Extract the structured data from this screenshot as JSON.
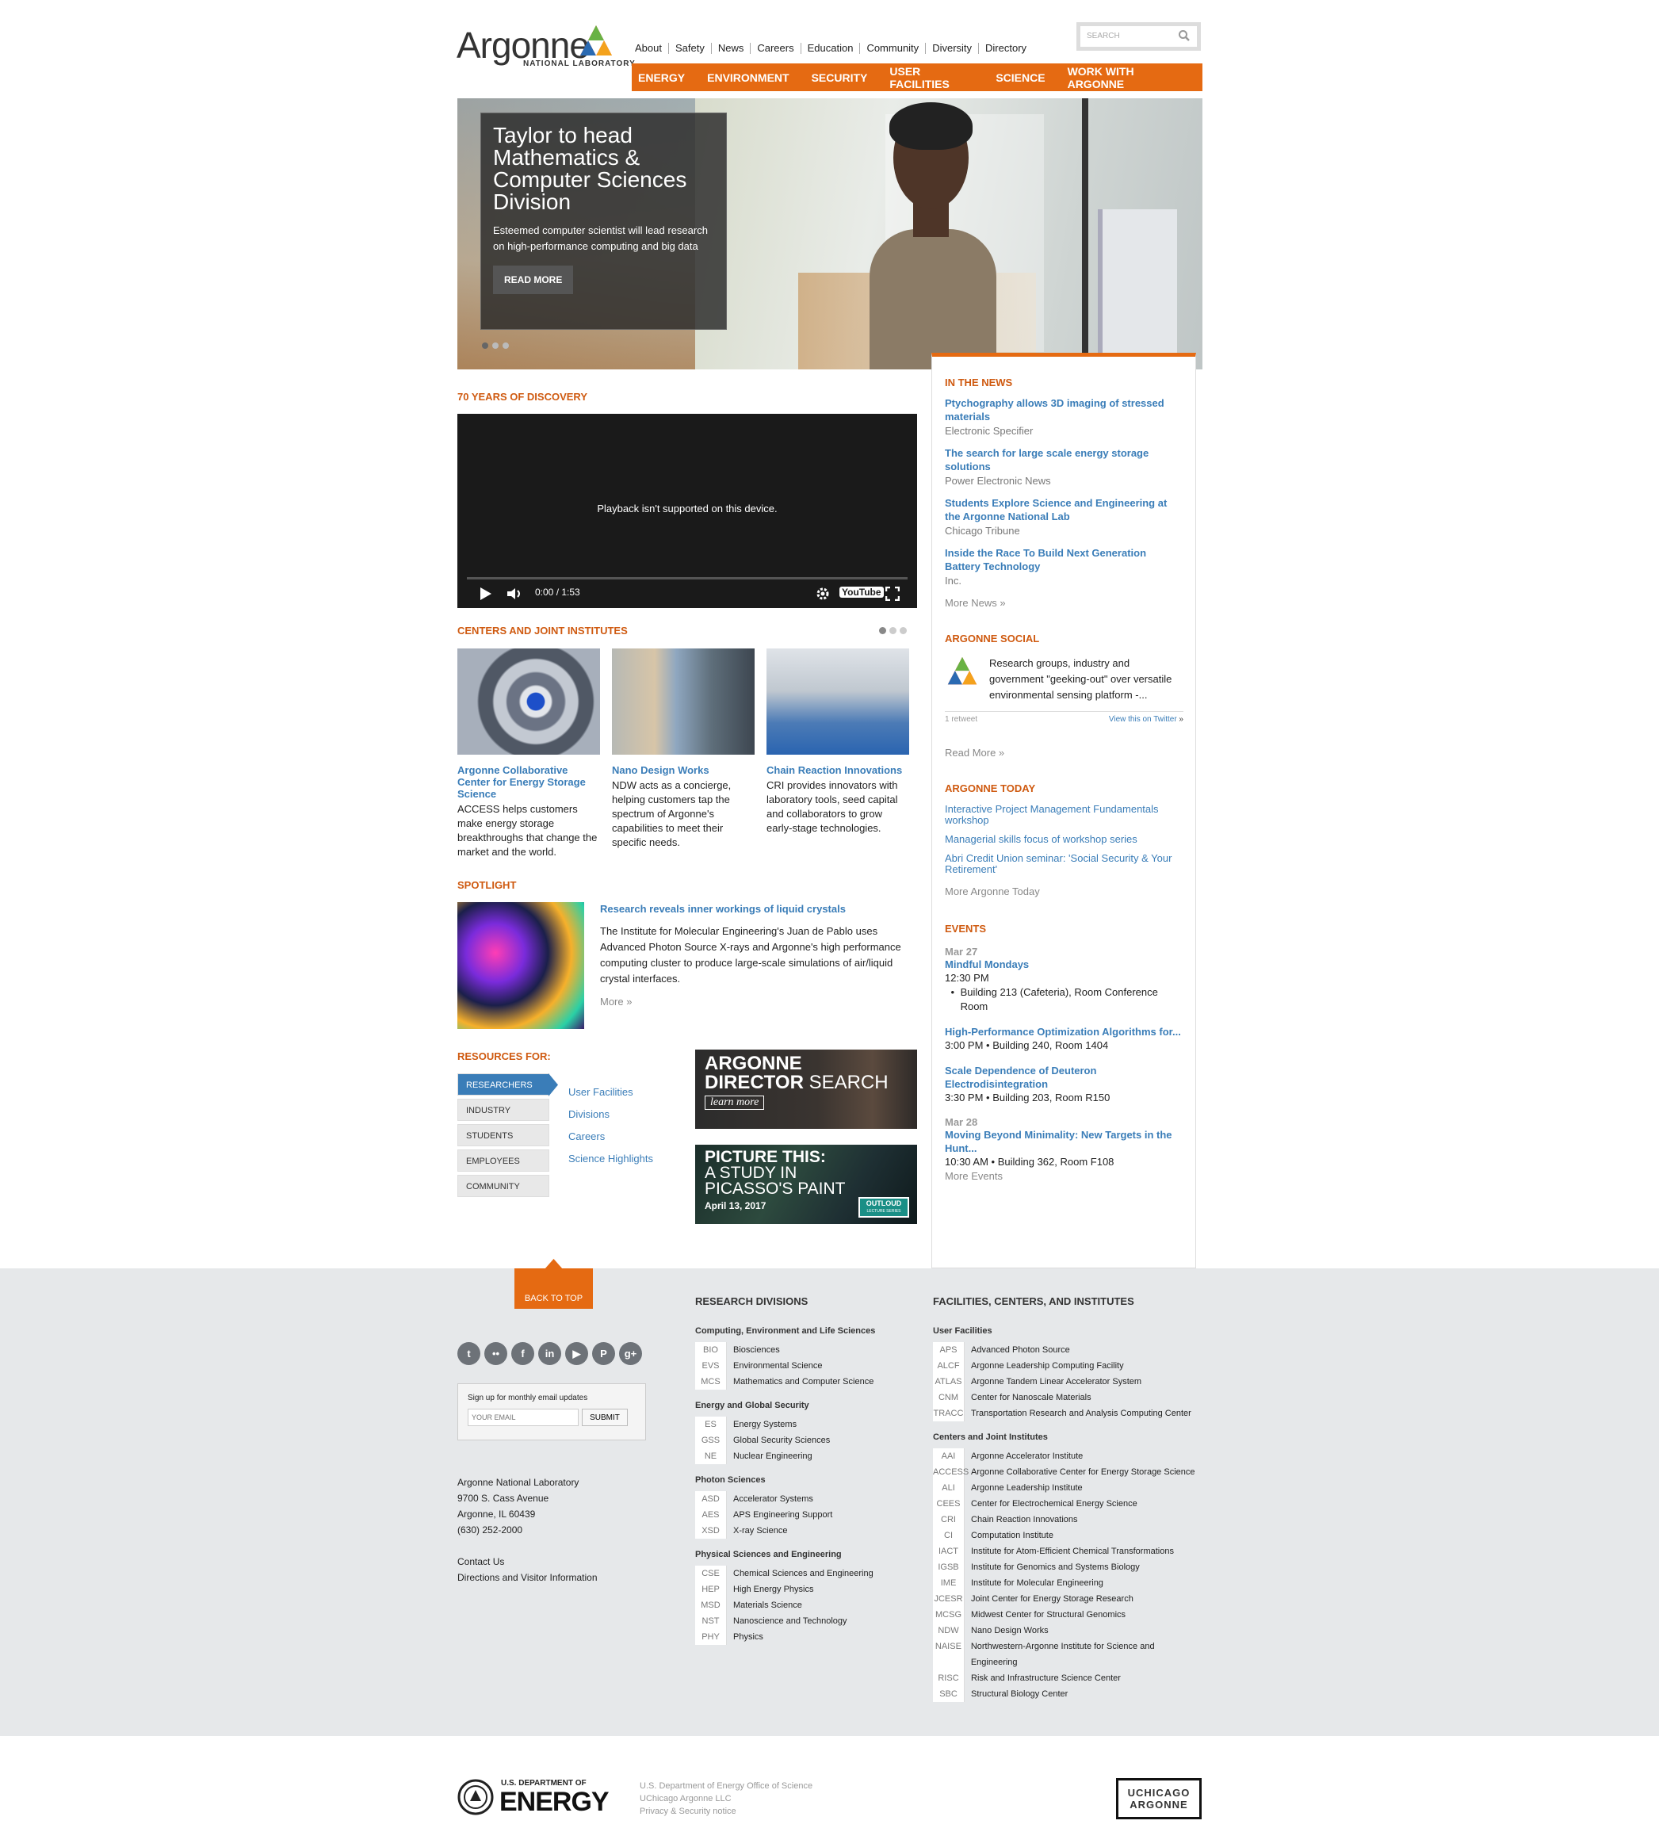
{
  "header": {
    "logo_text": "Argonne",
    "logo_sub": "NATIONAL LABORATORY",
    "top_nav": [
      "About",
      "Safety",
      "News",
      "Careers",
      "Education",
      "Community",
      "Diversity",
      "Directory"
    ],
    "search_placeholder": "SEARCH",
    "main_nav": [
      "ENERGY",
      "ENVIRONMENT",
      "SECURITY",
      "USER FACILITIES",
      "SCIENCE",
      "WORK WITH ARGONNE"
    ]
  },
  "hero": {
    "title": "Taylor to head Mathematics & Computer Sciences Division",
    "desc": "Esteemed computer scientist will lead research on high-performance computing and big data",
    "button": "READ MORE"
  },
  "discovery": {
    "title": "70 YEARS OF DISCOVERY",
    "video_msg": "Playback isn't supported on this device.",
    "video_time": "0:00 / 1:53",
    "youtube": "YouTube"
  },
  "centers": {
    "title": "CENTERS AND JOINT INSTITUTES",
    "items": [
      {
        "title": "Argonne Collaborative Center for Energy Storage Science",
        "text": "ACCESS helps customers make energy storage breakthroughs that change the market and the world."
      },
      {
        "title": "Nano Design Works",
        "text": "NDW acts as a concierge, helping customers tap the spectrum of Argonne's capabilities to meet their specific needs."
      },
      {
        "title": "Chain Reaction Innovations",
        "text": "CRI provides innovators with laboratory tools, seed capital and collaborators to grow early-stage technologies."
      }
    ]
  },
  "spotlight": {
    "title": "SPOTLIGHT",
    "headline": "Research reveals inner workings of liquid crystals",
    "text": "The Institute for Molecular Engineering's Juan de Pablo uses Advanced Photon Source X-rays and Argonne's high performance computing cluster to produce large-scale simulations of air/liquid crystal interfaces.",
    "more": "More"
  },
  "resources": {
    "title": "RESOURCES FOR:",
    "tabs": [
      "RESEARCHERS",
      "INDUSTRY",
      "STUDENTS",
      "EMPLOYEES",
      "COMMUNITY"
    ],
    "links": [
      "User Facilities",
      "Divisions",
      "Careers",
      "Science Highlights"
    ]
  },
  "ads": {
    "ad1_line1": "ARGONNE",
    "ad1_line2": "DIRECTOR",
    "ad1_line3": "SEARCH",
    "ad1_cta": "learn more",
    "ad2_line1": "PICTURE THIS:",
    "ad2_line2": "A STUDY IN",
    "ad2_line3": "PICASSO'S PAINT",
    "ad2_date": "April 13, 2017",
    "ad2_badge": "OUTLOUD",
    "ad2_badge_sub": "LECTURE SERIES"
  },
  "in_the_news": {
    "title": "IN THE NEWS",
    "items": [
      {
        "title": "Ptychography allows 3D imaging of stressed materials",
        "src": "Electronic Specifier"
      },
      {
        "title": "The search for large scale energy storage solutions",
        "src": "Power Electronic News"
      },
      {
        "title": "Students Explore Science and Engineering at the Argonne National Lab",
        "src": "Chicago Tribune"
      },
      {
        "title": "Inside the Race To Build Next Generation Battery Technology",
        "src": "Inc."
      }
    ],
    "more": "More News"
  },
  "social": {
    "title": "ARGONNE SOCIAL",
    "tweet": "Research groups, industry and government \"geeking-out\" over versatile environmental sensing platform -...",
    "retweets": "1 retweet",
    "view": "View this on Twitter",
    "more": "Read More"
  },
  "today": {
    "title": "ARGONNE TODAY",
    "items": [
      "Interactive Project Management Fundamentals workshop",
      "Managerial skills focus of workshop series",
      "Abri Credit Union seminar: 'Social Security & Your Retirement'"
    ],
    "more": "More Argonne Today"
  },
  "events": {
    "title": "EVENTS",
    "date1": "Mar 27",
    "e1_title": "Mindful Mondays",
    "e1_time": "12:30 PM",
    "e1_loc": "Building 213 (Cafeteria), Room Conference Room",
    "e2_title": "High-Performance Optimization Algorithms for...",
    "e2_meta": "3:00 PM  •  Building 240, Room 1404",
    "e3_title": "Scale Dependence of Deuteron Electrodisintegration",
    "e3_meta": "3:30 PM  •  Building 203, Room R150",
    "date2": "Mar 28",
    "e4_title": "Moving Beyond Minimality: New Targets in the Hunt...",
    "e4_meta": "10:30 AM  •  Building 362, Room F108",
    "more": "More Events"
  },
  "footer": {
    "back_top": "BACK TO TOP",
    "social_icons": [
      "twitter-icon",
      "flickr-icon",
      "facebook-icon",
      "linkedin-icon",
      "youtube-icon",
      "pinterest-icon",
      "googleplus-icon"
    ],
    "signup_label": "Sign up for monthly email updates",
    "email_placeholder": "YOUR EMAIL",
    "submit": "SUBMIT",
    "address": [
      "Argonne National Laboratory",
      "9700 S. Cass Avenue",
      "Argonne, IL 60439",
      "(630) 252-2000"
    ],
    "contact": "Contact Us",
    "directions": "Directions and Visitor Information",
    "research_title": "RESEARCH DIVISIONS",
    "research_groups": [
      {
        "name": "Computing, Environment and Life Sciences",
        "items": [
          [
            "BIO",
            "Biosciences"
          ],
          [
            "EVS",
            "Environmental Science"
          ],
          [
            "MCS",
            "Mathematics and Computer Science"
          ]
        ]
      },
      {
        "name": "Energy and Global Security",
        "items": [
          [
            "ES",
            "Energy Systems"
          ],
          [
            "GSS",
            "Global Security Sciences"
          ],
          [
            "NE",
            "Nuclear Engineering"
          ]
        ]
      },
      {
        "name": "Photon Sciences",
        "items": [
          [
            "ASD",
            "Accelerator Systems"
          ],
          [
            "AES",
            "APS Engineering Support"
          ],
          [
            "XSD",
            "X-ray Science"
          ]
        ]
      },
      {
        "name": "Physical Sciences and Engineering",
        "items": [
          [
            "CSE",
            "Chemical Sciences and Engineering"
          ],
          [
            "HEP",
            "High Energy Physics"
          ],
          [
            "MSD",
            "Materials Science"
          ],
          [
            "NST",
            "Nanoscience and Technology"
          ],
          [
            "PHY",
            "Physics"
          ]
        ]
      }
    ],
    "facilities_title": "FACILITIES, CENTERS, AND INSTITUTES",
    "facilities_groups": [
      {
        "name": "User Facilities",
        "items": [
          [
            "APS",
            "Advanced Photon Source"
          ],
          [
            "ALCF",
            "Argonne Leadership Computing Facility"
          ],
          [
            "ATLAS",
            "Argonne Tandem Linear Accelerator System"
          ],
          [
            "CNM",
            "Center for Nanoscale Materials"
          ],
          [
            "TRACC",
            "Transportation Research and Analysis Computing Center"
          ]
        ]
      },
      {
        "name": "Centers and Joint Institutes",
        "items": [
          [
            "AAI",
            "Argonne Accelerator Institute"
          ],
          [
            "ACCESS",
            "Argonne Collaborative Center for Energy Storage Science"
          ],
          [
            "ALI",
            "Argonne Leadership Institute"
          ],
          [
            "CEES",
            "Center for Electrochemical Energy Science"
          ],
          [
            "CRI",
            "Chain Reaction Innovations"
          ],
          [
            "CI",
            "Computation Institute"
          ],
          [
            "IACT",
            "Institute for Atom-Efficient Chemical Transformations"
          ],
          [
            "IGSB",
            "Institute for Genomics and Systems Biology"
          ],
          [
            "IME",
            "Institute for Molecular Engineering"
          ],
          [
            "JCESR",
            "Joint Center for Energy Storage Research"
          ],
          [
            "MCSG",
            "Midwest Center for Structural Genomics"
          ],
          [
            "NDW",
            "Nano Design Works"
          ],
          [
            "NAISE",
            "Northwestern-Argonne Institute for Science and Engineering"
          ],
          [
            "RISC",
            "Risk and Infrastructure Science Center"
          ],
          [
            "SBC",
            "Structural Biology Center"
          ]
        ]
      }
    ]
  },
  "bottom": {
    "doe_small": "U.S. DEPARTMENT OF",
    "doe_big": "ENERGY",
    "lines": [
      "U.S. Department of Energy Office of Science",
      "UChicago Argonne LLC",
      "Privacy & Security notice"
    ],
    "uchicago1": "UCHICAGO",
    "uchicago2": "ARGONNE"
  },
  "colors": {
    "accent": "#e56a12",
    "link": "#3a7db8",
    "footer_bg": "#e6e8ea"
  }
}
